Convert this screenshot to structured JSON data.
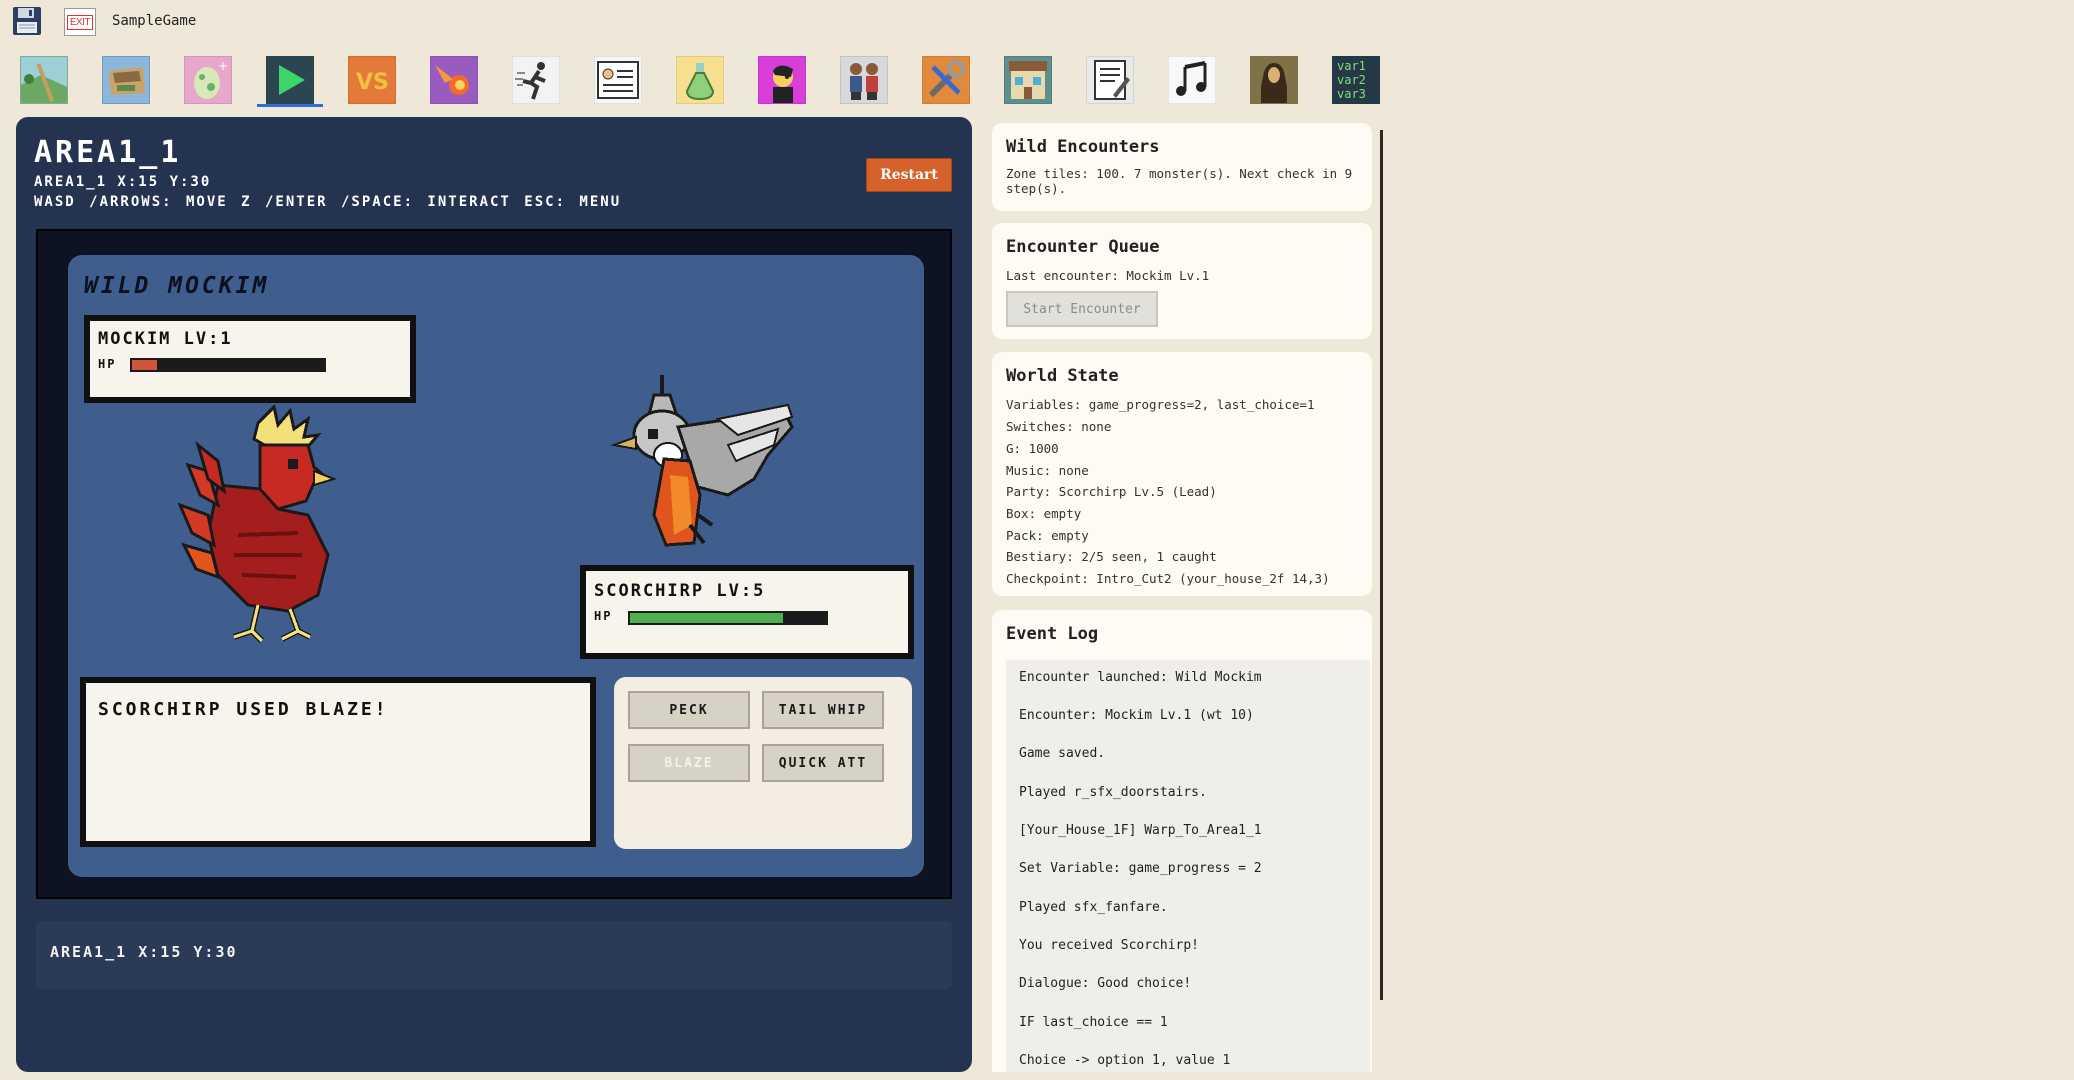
{
  "app": {
    "title": "SampleGame",
    "exit_label": "EXIT"
  },
  "toolbar": {
    "tools": [
      {
        "name": "map"
      },
      {
        "name": "tileset"
      },
      {
        "name": "egg"
      },
      {
        "name": "play"
      },
      {
        "name": "vs"
      },
      {
        "name": "fireball"
      },
      {
        "name": "running-man"
      },
      {
        "name": "dialogue"
      },
      {
        "name": "potion"
      },
      {
        "name": "portrait"
      },
      {
        "name": "characters"
      },
      {
        "name": "tools"
      },
      {
        "name": "building"
      },
      {
        "name": "script"
      },
      {
        "name": "music"
      },
      {
        "name": "painting"
      },
      {
        "name": "variables"
      }
    ],
    "vs_label": "VS",
    "var_labels": [
      "var1",
      "var2",
      "var3"
    ],
    "active_index": 3
  },
  "game": {
    "area_title": "AREA1_1",
    "coords": "AREA1_1  X:15 Y:30",
    "help": "WASD /ARROWS: MOVE  Z /ENTER /SPACE: INTERACT  ESC: MENU",
    "restart_label": "Restart",
    "battle": {
      "title": "WILD MOCKIM",
      "enemy": {
        "name": "MOCKIM",
        "level_text": "LV:1",
        "hp_label": "HP",
        "hp_fraction": 0.13,
        "hp_color": "#d0553a"
      },
      "player": {
        "name": "SCORCHIRP",
        "level_text": "LV:5",
        "hp_label": "HP",
        "hp_fraction": 0.78,
        "hp_color": "#4fb04f"
      },
      "message": "SCORCHIRP USED BLAZE!",
      "moves": [
        {
          "label": "PECK",
          "disabled": false
        },
        {
          "label": "TAIL WHIP",
          "disabled": false
        },
        {
          "label": "BLAZE",
          "disabled": true
        },
        {
          "label": "QUICK ATT",
          "disabled": false
        }
      ]
    },
    "status": "AREA1_1  X:15 Y:30"
  },
  "side": {
    "wild": {
      "title": "Wild Encounters",
      "line1": "Zone tiles: 100. 7 monster(s). Next check in 9",
      "line2": "step(s)."
    },
    "queue": {
      "title": "Encounter Queue",
      "last": "Last encounter: Mockim Lv.1",
      "button": "Start Encounter"
    },
    "world": {
      "title": "World State",
      "lines": [
        "Variables: game_progress=2, last_choice=1",
        "Switches: none",
        "G: 1000",
        "Music: none",
        "Party: Scorchirp Lv.5 (Lead)",
        "Box: empty",
        "Pack: empty",
        "Bestiary: 2/5 seen, 1 caught",
        "Checkpoint: Intro_Cut2 (your_house_2f 14,3)"
      ]
    },
    "log": {
      "title": "Event Log",
      "entries": [
        "Encounter launched: Wild Mockim",
        "Encounter: Mockim Lv.1 (wt 10)",
        "Game saved.",
        "Played r_sfx_doorstairs.",
        "[Your_House_1F] Warp_To_Area1_1",
        "Set Variable: game_progress = 2",
        "Played sfx_fanfare.",
        "You received Scorchirp!",
        "Dialogue: Good choice!",
        "IF last_choice == 1",
        "Choice -> option 1, value 1"
      ]
    }
  }
}
